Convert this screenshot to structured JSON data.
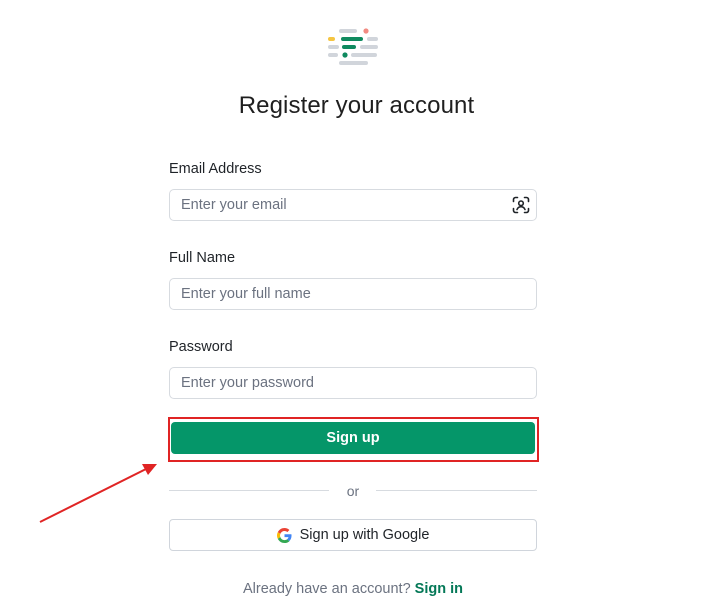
{
  "page": {
    "title": "Register your account"
  },
  "form": {
    "email": {
      "label": "Email Address",
      "placeholder": "Enter your email",
      "value": ""
    },
    "full_name": {
      "label": "Full Name",
      "placeholder": "Enter your full name",
      "value": ""
    },
    "password": {
      "label": "Password",
      "placeholder": "Enter your password",
      "value": ""
    },
    "submit_label": "Sign up"
  },
  "divider": {
    "text": "or"
  },
  "google": {
    "label": "Sign up with Google",
    "icon": "google-icon"
  },
  "footer": {
    "prompt": "Already have an account?",
    "link_label": "Sign in"
  },
  "annotation": {
    "highlight_color": "#e02424",
    "arrow_color": "#e02424"
  },
  "colors": {
    "primary": "#059669",
    "link": "#047857"
  }
}
